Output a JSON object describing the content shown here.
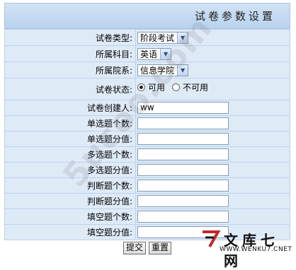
{
  "page": {
    "title": "试卷参数设置"
  },
  "form": {
    "exam_type": {
      "label": "试卷类型:",
      "value": "阶段考试"
    },
    "subject": {
      "label": "所属科目:",
      "value": "英语"
    },
    "department": {
      "label": "所属院系:",
      "value": "信息学院"
    },
    "status": {
      "label": "试卷状态:",
      "options": [
        "可用",
        "不可用"
      ],
      "selected": "可用"
    },
    "creator": {
      "label": "试卷创建人:",
      "value": "ww"
    },
    "single_count": {
      "label": "单选题个数:",
      "value": ""
    },
    "single_score": {
      "label": "单选题分值:",
      "value": ""
    },
    "multi_count": {
      "label": "多选题个数:",
      "value": ""
    },
    "multi_score": {
      "label": "多选题分值:",
      "value": ""
    },
    "judge_count": {
      "label": "判断题个数:",
      "value": ""
    },
    "judge_score": {
      "label": "判断题分值:",
      "value": ""
    },
    "fill_count": {
      "label": "填空题个数:",
      "value": ""
    },
    "fill_score": {
      "label": "填空题分值:",
      "value": ""
    }
  },
  "buttons": {
    "submit": "提交",
    "reset": "重置"
  },
  "watermark": {
    "text": "5ucoo.com"
  },
  "logo": {
    "name": "文库七网",
    "url": "WWW.WENKU7.CNET"
  },
  "colors": {
    "header_bg": "#c4daf1",
    "row_bg": "#dfeaf7",
    "border": "#bcd2ea"
  }
}
